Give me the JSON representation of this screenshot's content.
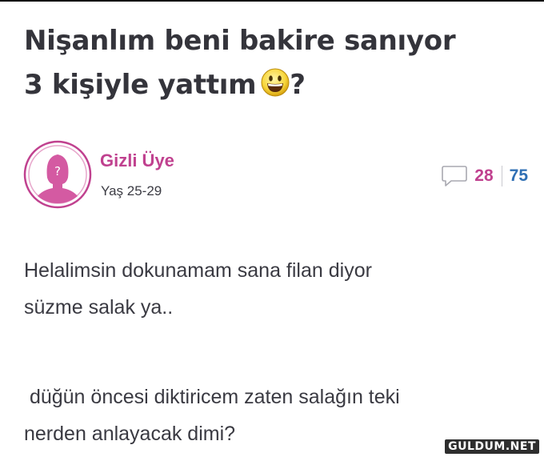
{
  "post": {
    "title_line1": "Nişanlım beni bakire sanıyor",
    "title_line2": "3 kişiyle yattım",
    "title_suffix": "?",
    "title_emoji": "grinning-face-emoji"
  },
  "author": {
    "name": "Gizli Üye",
    "age": "Yaş 25-29",
    "avatar_icon": "anonymous-female-avatar-icon",
    "avatar_mark": "?"
  },
  "stats": {
    "comment_icon": "comment-bubble-icon",
    "comments": "28",
    "views": "75"
  },
  "body": {
    "p1_line1": "Helalimsin dokunamam sana filan diyor",
    "p1_line2": "süzme salak ya..",
    "p2_line1": " düğün öncesi diktiricem zaten salağın teki",
    "p2_line2": "nerden anlayacak dimi?"
  },
  "watermark": {
    "text": "GULDUM.NET"
  },
  "colors": {
    "accent_pink": "#c0418f",
    "views_blue": "#2f6fb4",
    "text_dark": "#34343b"
  }
}
